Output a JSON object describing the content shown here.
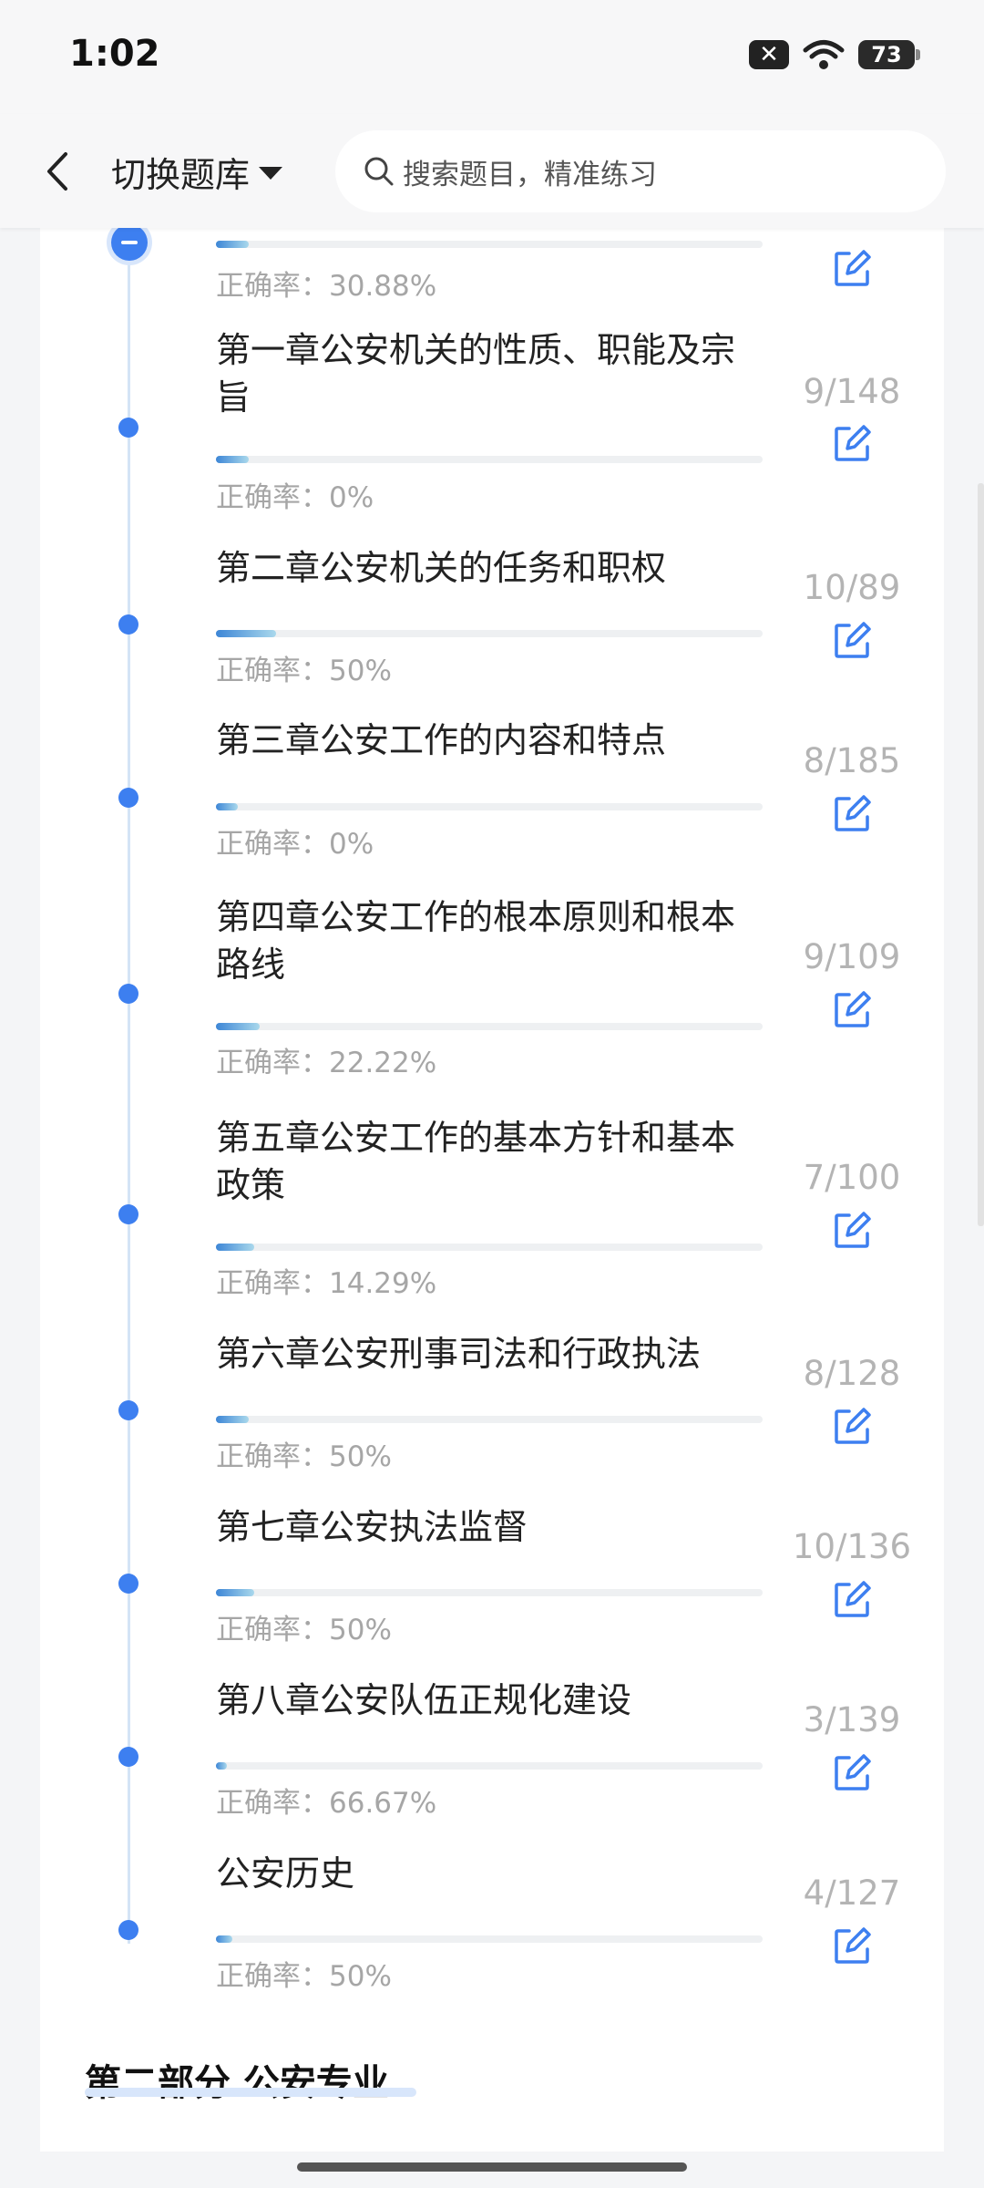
{
  "status_bar": {
    "time": "1:02",
    "battery": "73",
    "notification_badge": "✕"
  },
  "header": {
    "switch_bank_label": "切换题库",
    "search_placeholder": "搜索题目，精准练习",
    "icons": [
      "back-arrow-icon",
      "caret-down-icon",
      "search-icon"
    ]
  },
  "top_partial": {
    "accuracy": "正确率：30.88%",
    "progress": 0.06
  },
  "chapters": [
    {
      "title": "第一章公安机关的性质、职能及宗旨",
      "count": "9/148",
      "accuracy": "正确率：0%",
      "progress": 0.06
    },
    {
      "title": "第二章公安机关的任务和职权",
      "count": "10/89",
      "accuracy": "正确率：50%",
      "progress": 0.11
    },
    {
      "title": "第三章公安工作的内容和特点",
      "count": "8/185",
      "accuracy": "正确率：0%",
      "progress": 0.04
    },
    {
      "title": "第四章公安工作的根本原则和根本路线",
      "count": "9/109",
      "accuracy": "正确率：22.22%",
      "progress": 0.08
    },
    {
      "title": "第五章公安工作的基本方针和基本政策",
      "count": "7/100",
      "accuracy": "正确率：14.29%",
      "progress": 0.07
    },
    {
      "title": "第六章公安刑事司法和行政执法",
      "count": "8/128",
      "accuracy": "正确率：50%",
      "progress": 0.06
    },
    {
      "title": "第七章公安执法监督",
      "count": "10/136",
      "accuracy": "正确率：50%",
      "progress": 0.07
    },
    {
      "title": "第八章公安队伍正规化建设",
      "count": "3/139",
      "accuracy": "正确率：66.67%",
      "progress": 0.02
    },
    {
      "title": "公安历史",
      "count": "4/127",
      "accuracy": "正确率：50%",
      "progress": 0.03
    }
  ],
  "section_title": "第二部分 公安专业",
  "colors": {
    "accent": "#3d7ff0",
    "bar_start": "#3d86d6",
    "bar_end": "#a9d8ec",
    "muted_text": "#a6a6a6"
  }
}
